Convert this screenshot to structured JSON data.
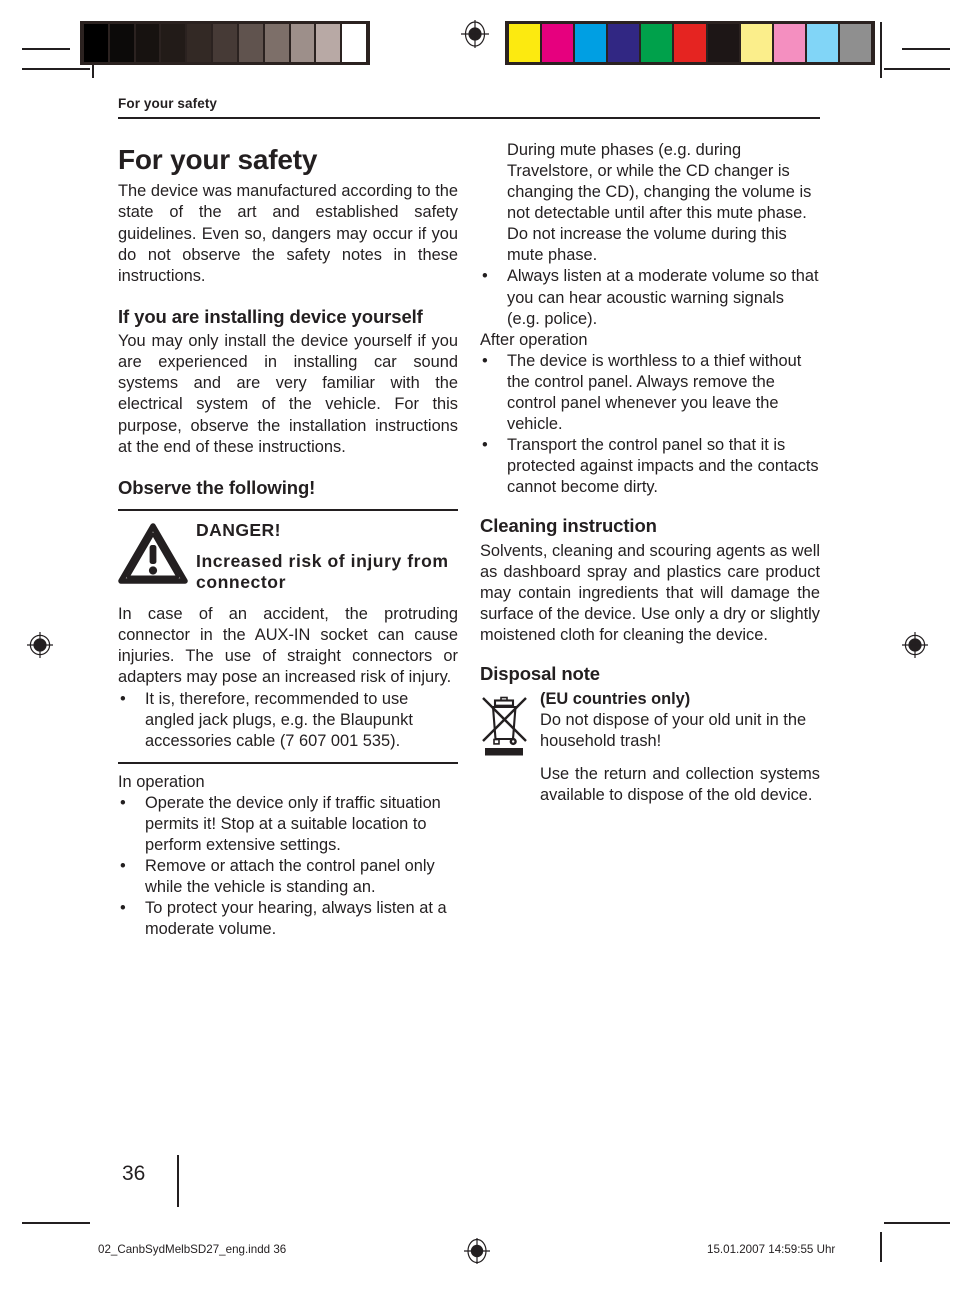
{
  "running_head": "For your safety",
  "title": "For your safety",
  "intro": "The device was manufactured according to the state of the art and established safety guidelines. Even so, dangers may occur if you do not observe the safety notes in these instructions.",
  "install_heading": "If you are installing device yourself",
  "install_text": "You may only install the device yourself if you are experienced in installing car sound systems and are very familiar with the electrical system of the vehicle. For this purpose, observe the installation instructions at the end of these instructions.",
  "observe_heading": "Observe the following!",
  "danger": {
    "icon": "warning-triangle-icon",
    "label": "DANGER!",
    "subject": "Increased risk of injury from connector",
    "body": "In case of an accident, the protruding connector in the AUX-IN socket can cause injuries. The use of straight connectors or adapters may pose an increased risk of injury.",
    "bullets": [
      "It is, therefore, recommended to use angled jack plugs, e.g. the Blaupunkt accessories cable (7 607 001 535)."
    ]
  },
  "in_operation": {
    "label": "In operation",
    "bullets": [
      "Operate the device only if traffic situation permits it! Stop at a suitable location to perform extensive settings.",
      "Remove or attach the control panel only while the vehicle is standing an.",
      "To protect your hearing, always listen at a moderate volume.",
      "During mute phases (e.g. during Travelstore, or while the CD changer is changing the CD), changing the volume is not detectable until after this mute phase. Do not increase the volume during this mute phase.",
      "Always listen at a moderate volume so that you can hear acoustic warning signals (e.g. police)."
    ]
  },
  "after_operation": {
    "label": "After operation",
    "bullets": [
      "The device is worthless to a thief without the control panel. Always remove the control panel whenever you leave the vehicle.",
      "Transport the control panel so that it is protected against impacts and the contacts cannot become dirty."
    ]
  },
  "cleaning": {
    "heading": "Cleaning instruction",
    "text": "Solvents, cleaning and scouring agents as well as dashboard spray and plastics care product may contain ingredients that will damage the surface of the device. Use only a dry or slightly moistened cloth for cleaning the device."
  },
  "disposal": {
    "heading": "Disposal note",
    "icon": "crossed-out-wheelie-bin-icon",
    "eu_label": "(EU countries only)",
    "line1": "Do not dispose of your old unit in the household trash!",
    "line2": "Use the return and collection systems available to dispose of the old device."
  },
  "page_number": "36",
  "footer": {
    "file": "02_CanbSydMelbSD27_eng.indd   36",
    "date": "15.01.2007   14:59:55 Uhr"
  },
  "calibration": {
    "gray_bar": [
      "#000000",
      "#0c0a09",
      "#171210",
      "#221b18",
      "#332925",
      "#463a36",
      "#60534e",
      "#7d6f69",
      "#9d8f8a",
      "#b8a9a5",
      "#ffffff"
    ],
    "color_bar": [
      "#fcea10",
      "#e6007e",
      "#009fe3",
      "#312783",
      "#00a14b",
      "#e52421",
      "#1d1616",
      "#fbee8b",
      "#f48fc0",
      "#81d5f7",
      "#8f8f8f"
    ]
  }
}
